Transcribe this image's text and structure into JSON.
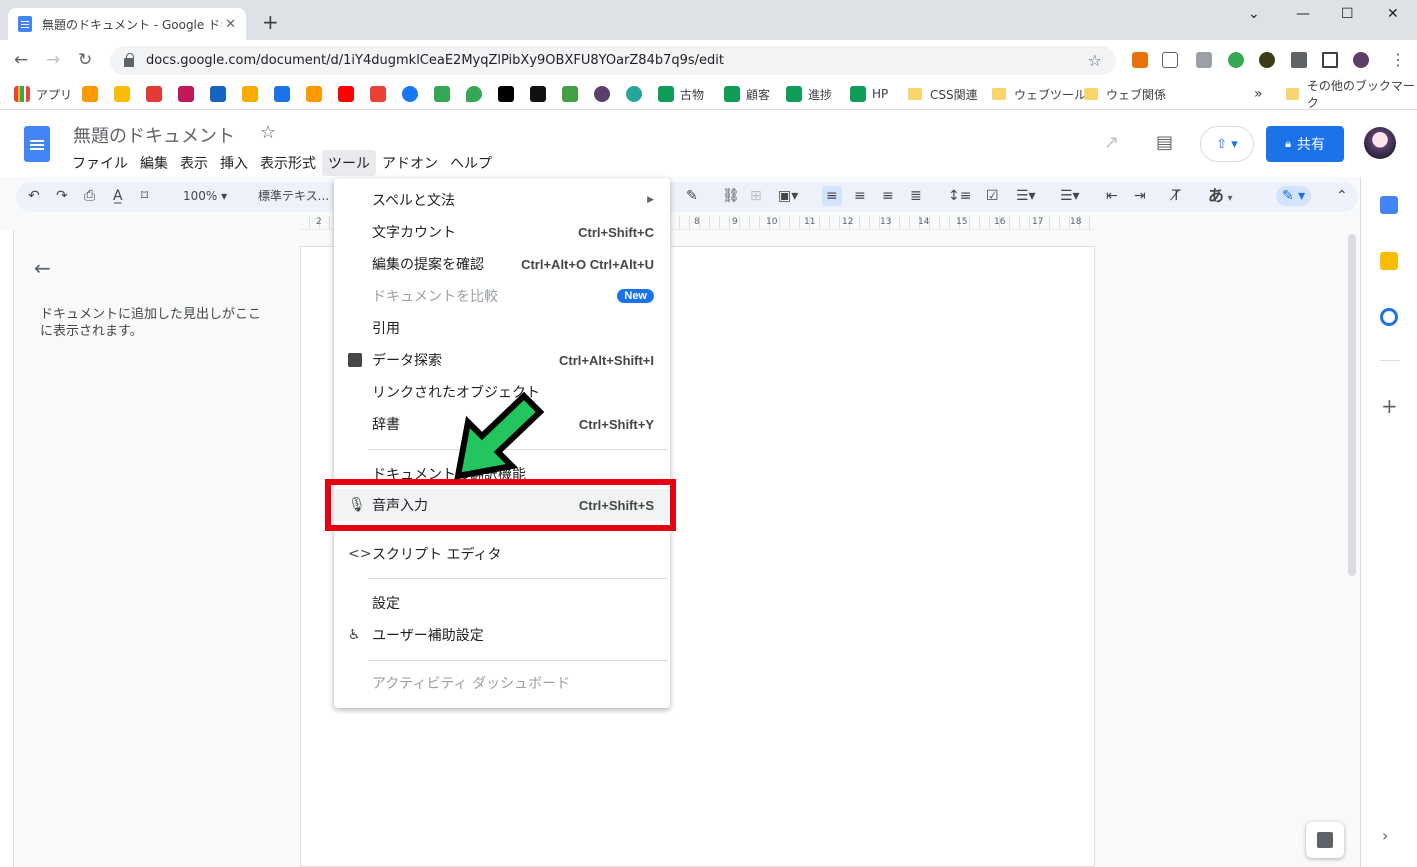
{
  "browser": {
    "tab_title": "無題のドキュメント - Google ドキュメント",
    "url": "docs.google.com/document/d/1iY4dugmklCeaE2MyqZlPibXy9OBXFU8YOarZ84b7q9s/edit",
    "bookmarks": [
      "アプリ",
      "古物",
      "顧客",
      "進捗",
      "HP",
      "CSS関連",
      "ウェブツール",
      "ウェブ関係"
    ],
    "other_bookmarks": "その他のブックマーク"
  },
  "docs": {
    "title": "無題のドキュメント",
    "menus": [
      "ファイル",
      "編集",
      "表示",
      "挿入",
      "表示形式",
      "ツール",
      "アドオン",
      "ヘルプ"
    ],
    "share": "共有",
    "zoom": "100%",
    "style": "標準テキス...",
    "font_glyph": "あ"
  },
  "outline": {
    "empty_text": "ドキュメントに追加した見出しがここに表示されます。"
  },
  "ruler": {
    "numbers": [
      "2",
      "8",
      "9",
      "10",
      "11",
      "12",
      "13",
      "14",
      "15",
      "16",
      "17",
      "18"
    ]
  },
  "tools_menu": {
    "items": [
      {
        "label": "スペルと文法",
        "shortcut": ""
      },
      {
        "label": "文字カウント",
        "shortcut": "Ctrl+Shift+C"
      },
      {
        "label": "編集の提案を確認",
        "shortcut": "Ctrl+Alt+O Ctrl+Alt+U"
      },
      {
        "label": "ドキュメントを比較",
        "shortcut": "",
        "badge": "New"
      },
      {
        "label": "引用",
        "shortcut": ""
      },
      {
        "label": "データ探索",
        "shortcut": "Ctrl+Alt+Shift+I"
      },
      {
        "label": "リンクされたオブジェクト",
        "shortcut": ""
      },
      {
        "label": "辞書",
        "shortcut": "Ctrl+Shift+Y"
      },
      {
        "label": "ドキュメントの翻訳機能",
        "shortcut": ""
      },
      {
        "label": "音声入力",
        "shortcut": "Ctrl+Shift+S"
      },
      {
        "label": "スクリプト エディタ",
        "shortcut": ""
      },
      {
        "label": "設定",
        "shortcut": ""
      },
      {
        "label": "ユーザー補助設定",
        "shortcut": ""
      },
      {
        "label": "アクティビティ ダッシュボード",
        "shortcut": ""
      }
    ]
  },
  "colors": {
    "accent": "#1a73e8",
    "highlight": "#e60012",
    "arrow": "#22c55e"
  }
}
